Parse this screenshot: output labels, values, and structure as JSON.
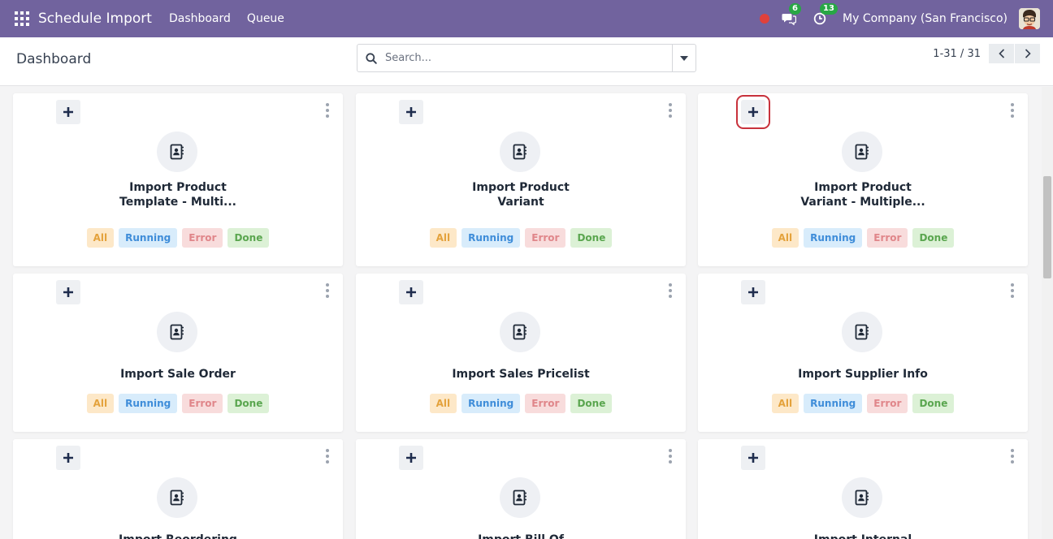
{
  "navbar": {
    "app_title": "Schedule Import",
    "menus": [
      "Dashboard",
      "Queue"
    ],
    "messages_badge": "6",
    "activities_badge": "13",
    "company": "My Company (San Francisco)",
    "icons": [
      "apps-grid-icon",
      "recording-dot-icon",
      "chat-bubbles-icon",
      "clock-icon",
      "user-avatar"
    ]
  },
  "control_panel": {
    "title": "Dashboard",
    "search_placeholder": "Search...",
    "pager": "1-31 / 31"
  },
  "cards": [
    {
      "title_lines": [
        "Import Product",
        "Template - Multi..."
      ],
      "tags": [
        "All",
        "Running",
        "Error",
        "Done"
      ]
    },
    {
      "title_lines": [
        "Import Product",
        "Variant"
      ],
      "tags": [
        "All",
        "Running",
        "Error",
        "Done"
      ]
    },
    {
      "title_lines": [
        "Import Product",
        "Variant - Multiple..."
      ],
      "tags": [
        "All",
        "Running",
        "Error",
        "Done"
      ]
    },
    {
      "title_lines": [
        "Import Sale Order"
      ],
      "tags": [
        "All",
        "Running",
        "Error",
        "Done"
      ]
    },
    {
      "title_lines": [
        "Import Sales Pricelist"
      ],
      "tags": [
        "All",
        "Running",
        "Error",
        "Done"
      ]
    },
    {
      "title_lines": [
        "Import Supplier Info"
      ],
      "tags": [
        "All",
        "Running",
        "Error",
        "Done"
      ]
    },
    {
      "title_lines": [
        "Import Reordering"
      ],
      "tags": []
    },
    {
      "title_lines": [
        "Import Bill Of"
      ],
      "tags": []
    },
    {
      "title_lines": [
        "Import Internal"
      ],
      "tags": []
    }
  ],
  "colors": {
    "navbar_bg": "#71639e",
    "tag_all": "#e4a23c",
    "tag_running": "#3f8dd9",
    "tag_error": "#e0868a",
    "tag_done": "#5aa64f"
  }
}
